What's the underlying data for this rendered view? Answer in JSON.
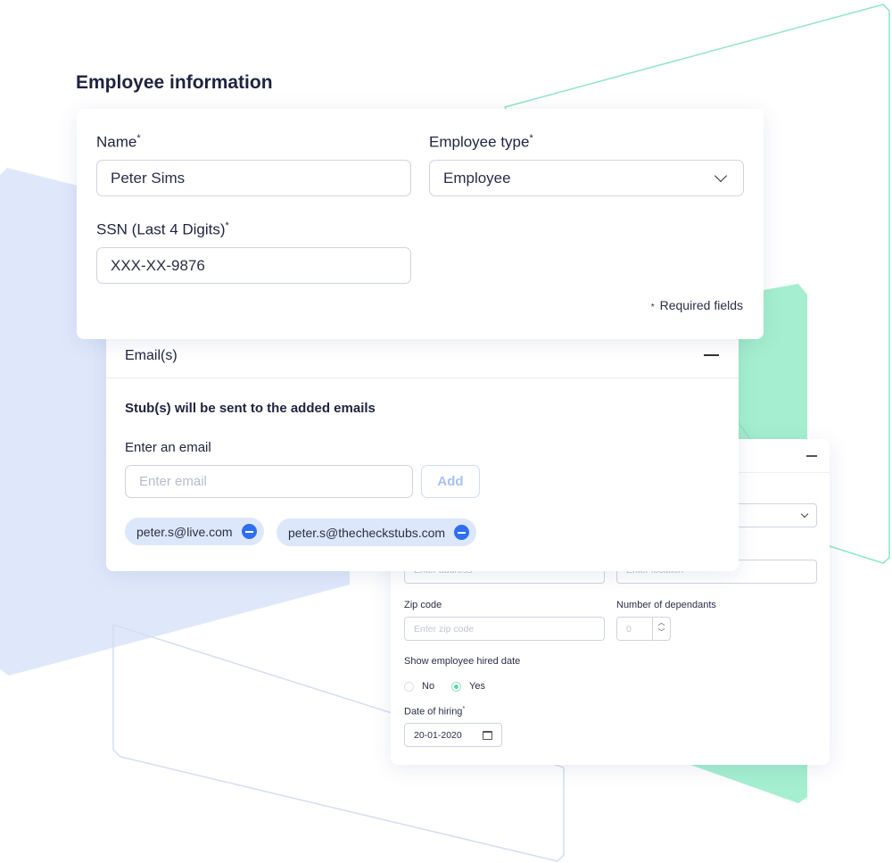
{
  "page_title": "Employee information",
  "colors": {
    "accent_blue": "#2f6ef0",
    "accent_green": "#5fd9a9",
    "bg_blue": "#dfe8fb",
    "bg_green": "#a5efd0"
  },
  "main_form": {
    "name_label": "Name",
    "name_value": "Peter Sims",
    "type_label": "Employee type",
    "type_value": "Employee",
    "ssn_label": "SSN (Last 4 Digits)",
    "ssn_value": "XXX-XX-9876",
    "required_star": "*",
    "required_note": "Required fields"
  },
  "emails": {
    "title": "Email(s)",
    "subtitle": "Stub(s) will be sent to the added emails",
    "input_label": "Enter an email",
    "input_placeholder": "Enter email",
    "add_label": "Add",
    "chips": [
      "peter.s@live.com",
      "peter.s@thecheckstubs.com"
    ]
  },
  "details": {
    "address_placeholder": "Enter address",
    "location_placeholder": "Enter location",
    "zip_label": "Zip code",
    "zip_placeholder": "Enter zip code",
    "dependants_label": "Number of dependants",
    "dependants_value": "0",
    "hired_label": "Show employee hired date",
    "radio_no": "No",
    "radio_yes": "Yes",
    "selected": "Yes",
    "date_label": "Date of hiring",
    "date_value": "20-01-2020"
  }
}
